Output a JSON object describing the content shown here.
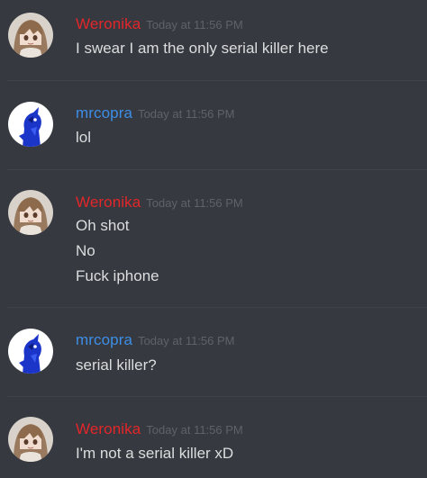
{
  "colors": {
    "background": "#36393f",
    "divider": "#3f4248",
    "message_text": "#dcddde",
    "timestamp": "#5f6369"
  },
  "messages": [
    {
      "author": "Weronika",
      "author_color": "#e3262a",
      "avatar_icon": "anime-girl-avatar-icon",
      "timestamp": "Today at 11:56 PM",
      "lines": [
        "I swear I am the only serial killer here"
      ]
    },
    {
      "author": "mrcopra",
      "author_color": "#3c8ee6",
      "avatar_icon": "blue-creature-avatar-icon",
      "timestamp": "Today at 11:56 PM",
      "lines": [
        "lol"
      ]
    },
    {
      "author": "Weronika",
      "author_color": "#e3262a",
      "avatar_icon": "anime-girl-avatar-icon",
      "timestamp": "Today at 11:56 PM",
      "lines": [
        "Oh shot",
        "No",
        "Fuck iphone"
      ]
    },
    {
      "author": "mrcopra",
      "author_color": "#3c8ee6",
      "avatar_icon": "blue-creature-avatar-icon",
      "timestamp": "Today at 11:56 PM",
      "lines": [
        "serial killer?"
      ]
    },
    {
      "author": "Weronika",
      "author_color": "#e3262a",
      "avatar_icon": "anime-girl-avatar-icon",
      "timestamp": "Today at 11:56 PM",
      "lines": [
        "I'm not a serial killer xD"
      ]
    }
  ]
}
